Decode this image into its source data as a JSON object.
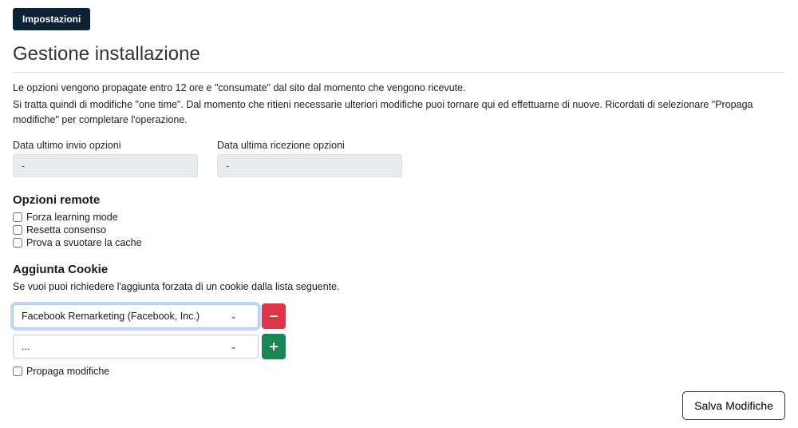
{
  "topButton": "Impostazioni",
  "pageTitle": "Gestione installazione",
  "description": {
    "line1": "Le opzioni vengono propagate entro 12 ore e \"consumate\" dal sito dal momento che vengono ricevute.",
    "line2": "Si tratta quindi di modifiche \"one time\". Dal momento che ritieni necessarie ulteriori modifiche puoi tornare qui ed effettuarne di nuove. Ricordati di selezionare \"Propaga modifiche\" per completare l'operazione."
  },
  "dates": {
    "sentLabel": "Data ultimo invio opzioni",
    "sentValue": "-",
    "recvLabel": "Data ultima ricezione opzioni",
    "recvValue": "-"
  },
  "remoteOptions": {
    "title": "Opzioni remote",
    "items": [
      "Forza learning mode",
      "Resetta consenso",
      "Prova a svuotare la cache"
    ]
  },
  "addCookie": {
    "title": "Aggiunta Cookie",
    "desc": "Se vuoi puoi richiedere l'aggiunta forzata di un cookie dalla lista seguente.",
    "selects": [
      {
        "value": "Facebook Remarketing (Facebook, Inc.)",
        "action": "remove",
        "highlight": true
      },
      {
        "value": "...",
        "action": "add",
        "highlight": false
      }
    ]
  },
  "propagateLabel": "Propaga modifiche",
  "saveLabel": "Salva Modifiche"
}
